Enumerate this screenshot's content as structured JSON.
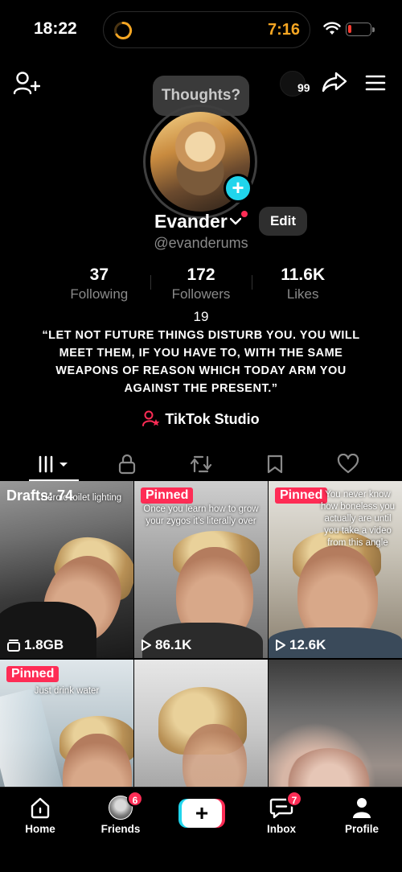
{
  "status_bar": {
    "time": "18:22",
    "timer": "7:16",
    "battery_level": 0.15,
    "timer_color": "#f5a623",
    "icons": [
      "timer-ring-icon",
      "wifi-icon",
      "battery-icon"
    ]
  },
  "header": {
    "thoughts_label": "Thoughts?",
    "notification_count": "99",
    "icons": [
      "add-friend-icon",
      "share-icon",
      "menu-icon"
    ]
  },
  "profile": {
    "display_name": "Evander",
    "handle": "@evanderums",
    "edit_label": "Edit",
    "stats": [
      {
        "value": "37",
        "label": "Following"
      },
      {
        "value": "172",
        "label": "Followers"
      },
      {
        "value": "11.6K",
        "label": "Likes"
      }
    ],
    "age": "19",
    "bio": "“LET NOT FUTURE THINGS DISTURB YOU. YOU WILL MEET THEM, IF YOU HAVE TO, WITH THE SAME WEAPONS OF REASON WHICH TODAY ARM YOU AGAINST THE PRESENT.”",
    "studio_label": "TikTok Studio"
  },
  "tabs": [
    "videos-tab",
    "private-tab",
    "reposts-tab",
    "favorites-tab",
    "liked-tab"
  ],
  "grid": [
    {
      "label": "Drafts: 74",
      "caption": "Heroic toilet lighting",
      "count": "1.8GB",
      "count_icon": "drafts-stack-icon"
    },
    {
      "label": "Pinned",
      "caption": "Once you learn how to grow your zygos it’s literally over",
      "count": "86.1K",
      "count_icon": "play-icon"
    },
    {
      "label": "Pinned",
      "caption": "You never know how boneless you actually are until you take a video from this angle",
      "count": "12.6K",
      "count_icon": "play-icon"
    },
    {
      "label": "Pinned",
      "caption": "Just drink water",
      "count": "",
      "count_icon": ""
    },
    {
      "label": "",
      "caption": "",
      "count": "",
      "count_icon": ""
    },
    {
      "label": "",
      "caption": "",
      "count": "",
      "count_icon": ""
    }
  ],
  "nav": {
    "home": "Home",
    "friends": "Friends",
    "friends_badge": "6",
    "inbox": "Inbox",
    "inbox_badge": "7",
    "profile": "Profile"
  },
  "colors": {
    "accent_red": "#fe2c55",
    "accent_cyan": "#20d5ec",
    "muted": "#8a8a8a"
  }
}
